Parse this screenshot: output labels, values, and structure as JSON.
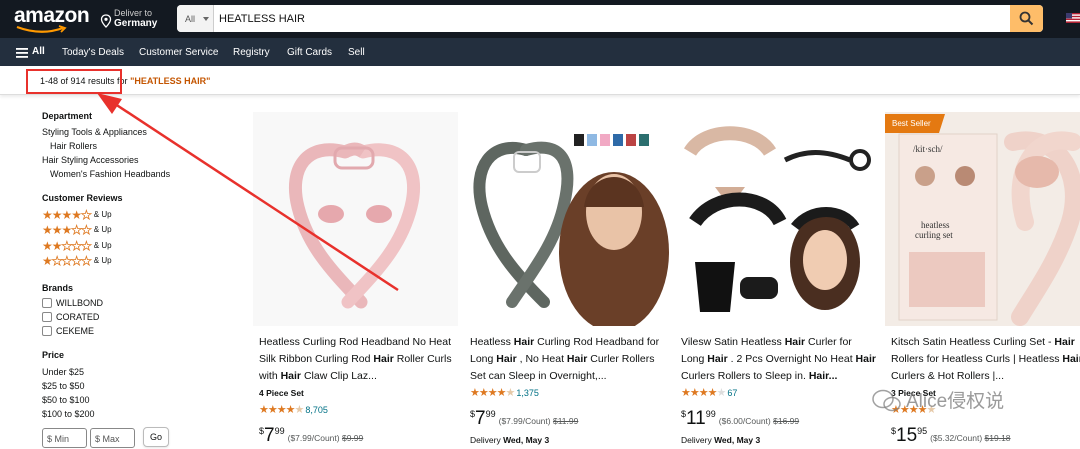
{
  "header": {
    "logo": "amazon",
    "deliver_line1": "Deliver to",
    "deliver_line2": "Germany",
    "search_category": "All",
    "search_value": "HEATLESS HAIR"
  },
  "nav": {
    "all_label": "All",
    "items": [
      "Today's Deals",
      "Customer Service",
      "Registry",
      "Gift Cards",
      "Sell"
    ]
  },
  "results": {
    "count_text": "1-48 of 914 results for ",
    "query_text": "\"HEATLESS HAIR\""
  },
  "sidebar": {
    "department_heading": "Department",
    "department_links": [
      "Styling Tools & Appliances",
      "Hair Rollers",
      "Hair Styling Accessories",
      "Women's Fashion Headbands"
    ],
    "reviews_heading": "Customer Reviews",
    "review_rows": [
      {
        "stars": 4,
        "label": "& Up"
      },
      {
        "stars": 3,
        "label": "& Up"
      },
      {
        "stars": 2,
        "label": "& Up"
      },
      {
        "stars": 1,
        "label": "& Up"
      }
    ],
    "brands_heading": "Brands",
    "brands": [
      "WILLBOND",
      "CORATED",
      "CEKEME"
    ],
    "price_heading": "Price",
    "price_ranges": [
      "Under $25",
      "$25 to $50",
      "$50 to $100",
      "$100 to $200"
    ],
    "min_placeholder": "$ Min",
    "max_placeholder": "$ Max",
    "go_label": "Go"
  },
  "products": [
    {
      "title_parts": [
        [
          "Heatless Curling Rod Headband No Heat Silk Ribbon Curling Rod ",
          false
        ],
        [
          "Hair",
          true
        ],
        [
          " Roller Curls with ",
          false
        ],
        [
          "Hair",
          true
        ],
        [
          " Claw Clip Laz...",
          false
        ]
      ],
      "variant": "4 Piece Set",
      "rating": 4.5,
      "reviews": "8,705",
      "price_whole": "7",
      "price_cents": "99",
      "unit_price": "($7.99/Count)",
      "list_price": "$9.99",
      "delivery_label": "",
      "delivery_date": "",
      "badge": ""
    },
    {
      "title_parts": [
        [
          "Heatless ",
          false
        ],
        [
          "Hair",
          true
        ],
        [
          " Curling Rod Headband for Long ",
          false
        ],
        [
          "Hair",
          true
        ],
        [
          " , No Heat ",
          false
        ],
        [
          "Hair",
          true
        ],
        [
          " Curler Rollers Set can Sleep in Overnight,...",
          false
        ]
      ],
      "variant": "",
      "rating": 4.5,
      "reviews": "1,375",
      "price_whole": "7",
      "price_cents": "99",
      "unit_price": "($7.99/Count)",
      "list_price": "$11.99",
      "delivery_label": "Delivery ",
      "delivery_date": "Wed, May 3",
      "badge": ""
    },
    {
      "title_parts": [
        [
          "Vilesw Satin Heatless ",
          false
        ],
        [
          "Hair",
          true
        ],
        [
          " Curler for Long ",
          false
        ],
        [
          "Hair",
          true
        ],
        [
          " . 2 Pcs Overnight No Heat ",
          false
        ],
        [
          "Hair",
          true
        ],
        [
          " Curlers Rollers to Sleep in. ",
          false
        ],
        [
          "Hair...",
          true
        ]
      ],
      "variant": "",
      "rating": 4.0,
      "reviews": "67",
      "price_whole": "11",
      "price_cents": "99",
      "unit_price": "($6.00/Count)",
      "list_price": "$16.99",
      "delivery_label": "Delivery ",
      "delivery_date": "Wed, May 3",
      "badge": ""
    },
    {
      "title_parts": [
        [
          "Kitsch Satin Heatless Curling Set - ",
          false
        ],
        [
          "Hair",
          true
        ],
        [
          " Rollers for Heatless Curls | Heatless ",
          false
        ],
        [
          "Hair",
          true
        ],
        [
          " Curlers & Hot Rollers |...",
          false
        ]
      ],
      "variant": "3 Piece Set",
      "rating": 4.5,
      "reviews": "",
      "price_whole": "15",
      "price_cents": "95",
      "unit_price": "($5.32/Count)",
      "list_price": "$19.18",
      "delivery_label": "",
      "delivery_date": "",
      "badge": "Best Seller"
    }
  ],
  "watermark": "Alice侵权说",
  "colors": {
    "header_bg": "#131921",
    "nav_bg": "#232f3e",
    "search_button": "#febd69",
    "query_orange": "#c45500",
    "star": "#de7921",
    "link_teal": "#007185",
    "annotation_red": "#e8312c",
    "badge_orange": "#e47911"
  }
}
